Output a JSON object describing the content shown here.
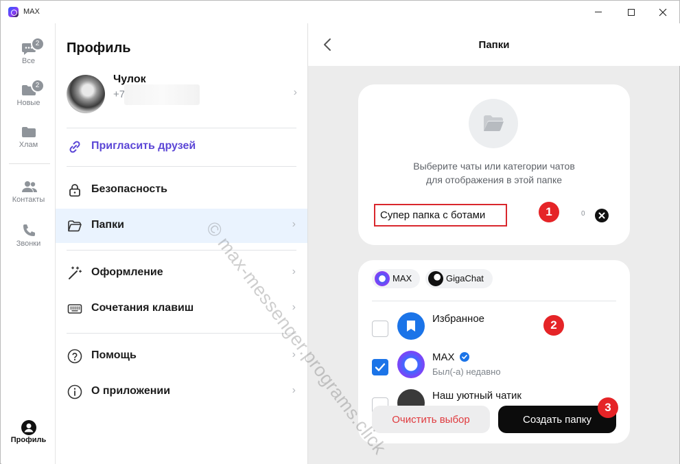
{
  "window": {
    "title": "MAX"
  },
  "rail": {
    "items": [
      {
        "label": "Все",
        "badge": "2",
        "icon": "chats-icon"
      },
      {
        "label": "Новые",
        "badge": "2",
        "icon": "folder-new-icon"
      },
      {
        "label": "Хлам",
        "icon": "folder-junk-icon"
      },
      {
        "label": "Контакты",
        "icon": "contacts-icon"
      },
      {
        "label": "Звонки",
        "icon": "phone-icon"
      }
    ],
    "profile_label": "Профиль"
  },
  "profile": {
    "title": "Профиль",
    "user_name": "Чулок",
    "user_phone": "+7",
    "menu": [
      {
        "label": "Пригласить друзей",
        "icon": "link-icon"
      },
      {
        "label": "Безопасность",
        "icon": "lock-icon"
      },
      {
        "label": "Папки",
        "icon": "folder-icon"
      },
      {
        "label": "Оформление",
        "icon": "magic-wand-icon"
      },
      {
        "label": "Сочетания клавиш",
        "icon": "keyboard-icon"
      },
      {
        "label": "Помощь",
        "icon": "help-icon"
      },
      {
        "label": "О приложении",
        "icon": "info-icon"
      }
    ]
  },
  "folder": {
    "header_title": "Папки",
    "hint": "Выберите чаты или категории чатов для отображения в этой папке",
    "hint_line1": "Выберите чаты или категории чатов",
    "hint_line2": "для отображения в этой папке",
    "name_value": "Супер папка с ботами",
    "char_count": "0",
    "chips": [
      "MAX",
      "GigaChat"
    ],
    "chats": [
      {
        "name": "Избранное",
        "subtitle": "",
        "checked": false
      },
      {
        "name": "MAX",
        "subtitle": "Был(-а) недавно",
        "checked": true
      },
      {
        "name": "Наш уютный чатик",
        "subtitle": "",
        "checked": false
      }
    ],
    "clear_button": "Очистить выбор",
    "create_button": "Создать папку"
  },
  "markers": [
    "1",
    "2",
    "3"
  ],
  "watermark": "© max-messenger.programs.click",
  "colors": {
    "accent": "#1b74e8",
    "marker": "#e52427",
    "invite": "#5b46d6",
    "danger": "#e03a3e"
  }
}
